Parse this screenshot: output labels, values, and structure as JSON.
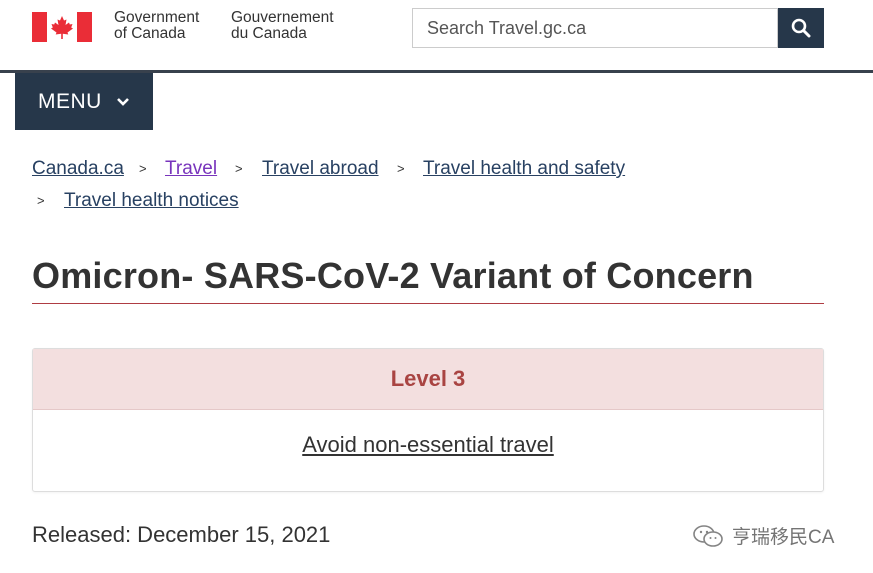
{
  "header": {
    "gov_en_line1": "Government",
    "gov_en_line2": "of Canada",
    "gov_fr_line1": "Gouvernement",
    "gov_fr_line2": "du Canada",
    "flag_icon": "canada-flag-icon",
    "search_placeholder": "Search Travel.gc.ca",
    "search_icon": "search-icon"
  },
  "menu": {
    "label": "MENU",
    "icon": "chevron-down-icon"
  },
  "breadcrumb": {
    "separator": ">",
    "items": [
      {
        "label": "Canada.ca"
      },
      {
        "label": "Travel"
      },
      {
        "label": "Travel abroad"
      },
      {
        "label": "Travel health and safety"
      },
      {
        "label": "Travel health notices"
      }
    ]
  },
  "page": {
    "title": "Omicron- SARS-CoV-2 Variant of Concern",
    "alert_level": "Level 3",
    "alert_action": "Avoid non-essential travel",
    "released": "Released: December 15, 2021"
  },
  "watermark": {
    "text": "亨瑞移民CA",
    "icon": "wechat-icon"
  },
  "colors": {
    "navy": "#26374a",
    "link": "#284162",
    "visited_link": "#7834bc",
    "title_rule": "#af3c43",
    "alert_bg": "#f3dfdf",
    "alert_text": "#a94442"
  }
}
